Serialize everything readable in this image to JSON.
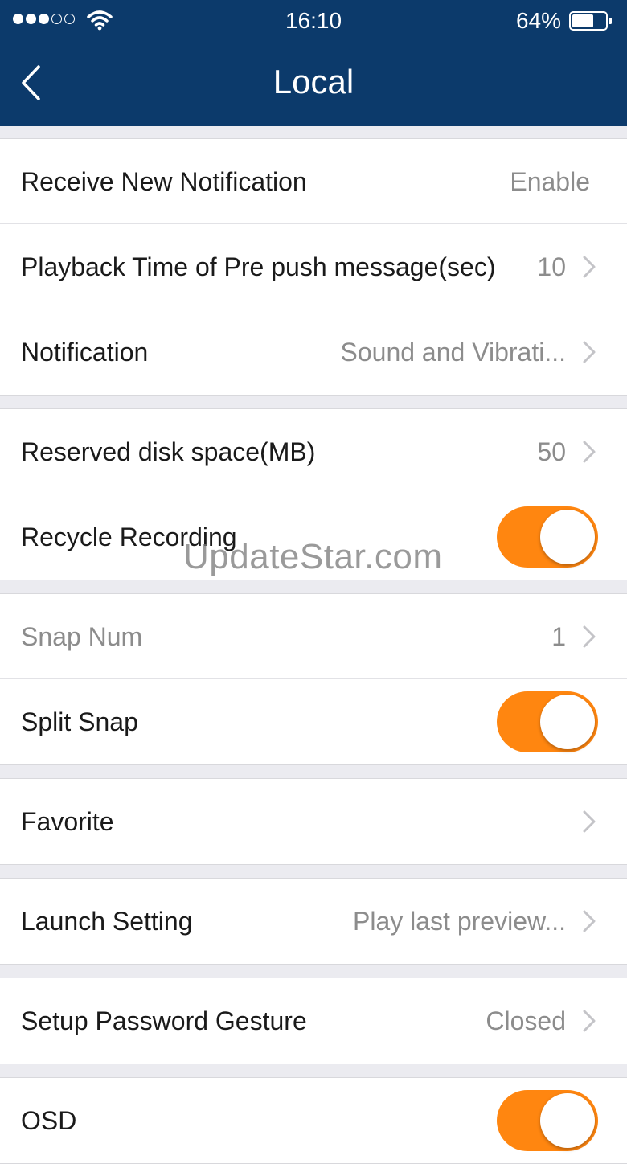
{
  "status_bar": {
    "time": "16:10",
    "battery_percent": "64%",
    "battery_level": 0.64,
    "signal_bars_filled": 3,
    "signal_bars_total": 5,
    "wifi_icon": "wifi-icon"
  },
  "nav": {
    "title": "Local",
    "back_icon": "chevron-left-icon"
  },
  "settings": {
    "receive_notification": {
      "label": "Receive New Notification",
      "value": "Enable"
    },
    "playback_time": {
      "label": "Playback Time of Pre push message(sec)",
      "value": "10"
    },
    "notification": {
      "label": "Notification",
      "value": "Sound and Vibrati..."
    },
    "reserved_disk": {
      "label": "Reserved disk space(MB)",
      "value": "50"
    },
    "recycle_recording": {
      "label": "Recycle Recording",
      "on": true
    },
    "snap_num": {
      "label": "Snap Num",
      "value": "1"
    },
    "split_snap": {
      "label": "Split Snap",
      "on": true
    },
    "favorite": {
      "label": "Favorite"
    },
    "launch_setting": {
      "label": "Launch Setting",
      "value": "Play last preview..."
    },
    "password_gesture": {
      "label": "Setup Password Gesture",
      "value": "Closed"
    },
    "osd": {
      "label": "OSD",
      "on": true
    }
  },
  "watermark": "UpdateStar.com",
  "colors": {
    "navbar": "#0c3a6b",
    "toggle_on": "#ff8610",
    "background": "#ebebf0"
  }
}
